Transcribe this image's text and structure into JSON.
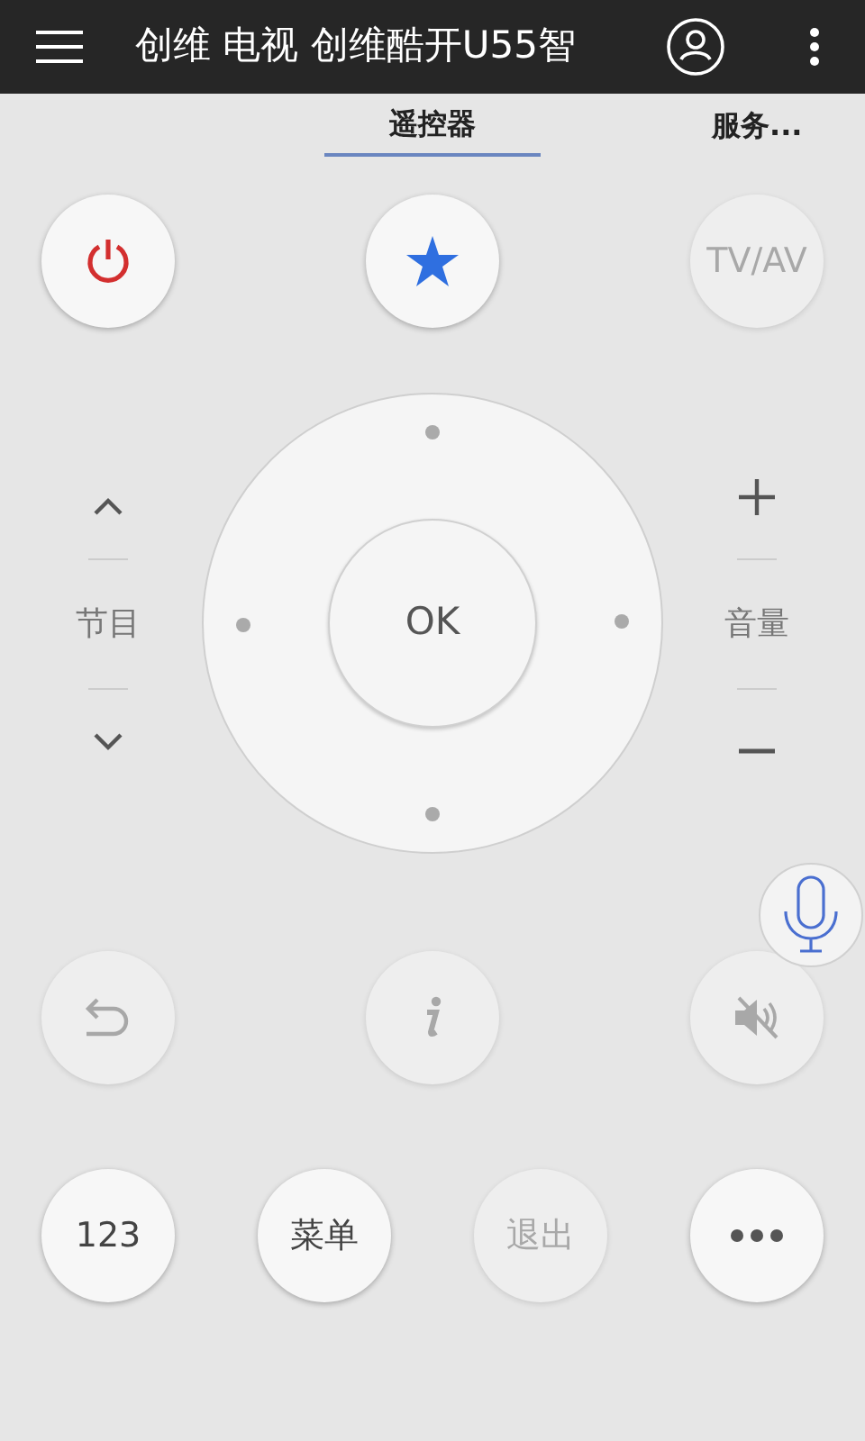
{
  "top_bar": {
    "title": "创维 电视 创维酷开U55智"
  },
  "tabs": [
    {
      "label": "遥控器",
      "selected": true
    },
    {
      "label": "服务...",
      "selected": false
    }
  ],
  "row_1": [
    {
      "kind": "power",
      "disabled": false
    },
    {
      "kind": "favorite",
      "disabled": false
    },
    {
      "kind": "text",
      "label": "TV/AV",
      "disabled": true
    }
  ],
  "channel": {
    "label": "节目"
  },
  "dpad": {
    "ok_label": "OK"
  },
  "volume": {
    "label": "音量"
  },
  "row_2": [
    {
      "kind": "back",
      "disabled": true
    },
    {
      "kind": "info",
      "disabled": true
    },
    {
      "kind": "mute",
      "disabled": true
    }
  ],
  "row_3": [
    {
      "kind": "text",
      "label": "123",
      "disabled": false
    },
    {
      "kind": "text",
      "label": "菜单",
      "disabled": false
    },
    {
      "kind": "text",
      "label": "退出",
      "disabled": true
    },
    {
      "kind": "more",
      "disabled": false
    }
  ]
}
